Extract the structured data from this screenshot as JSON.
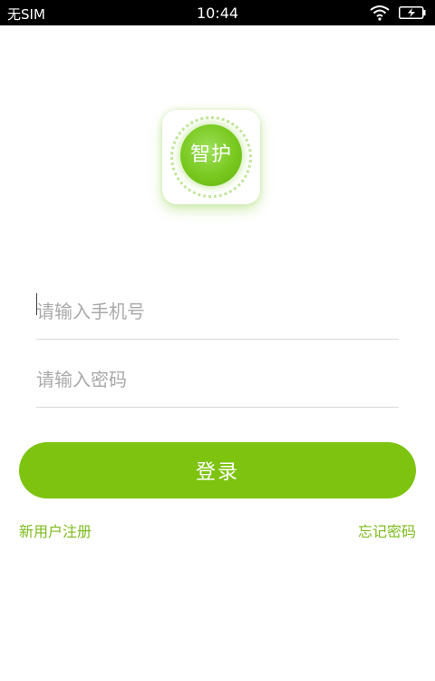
{
  "status_bar": {
    "carrier": "无SIM",
    "time": "10:44",
    "wifi_icon": "wifi-icon",
    "battery_icon": "battery-charging-icon"
  },
  "logo": {
    "text": "智护"
  },
  "form": {
    "phone_placeholder": "请输入手机号",
    "phone_value": "",
    "password_placeholder": "请输入密码",
    "password_value": ""
  },
  "login_button": {
    "label": "登录"
  },
  "links": {
    "register": "新用户注册",
    "forgot_password": "忘记密码"
  },
  "colors": {
    "accent": "#7dc30f",
    "link": "#7dbb1c",
    "status_bar_bg": "#000000"
  }
}
